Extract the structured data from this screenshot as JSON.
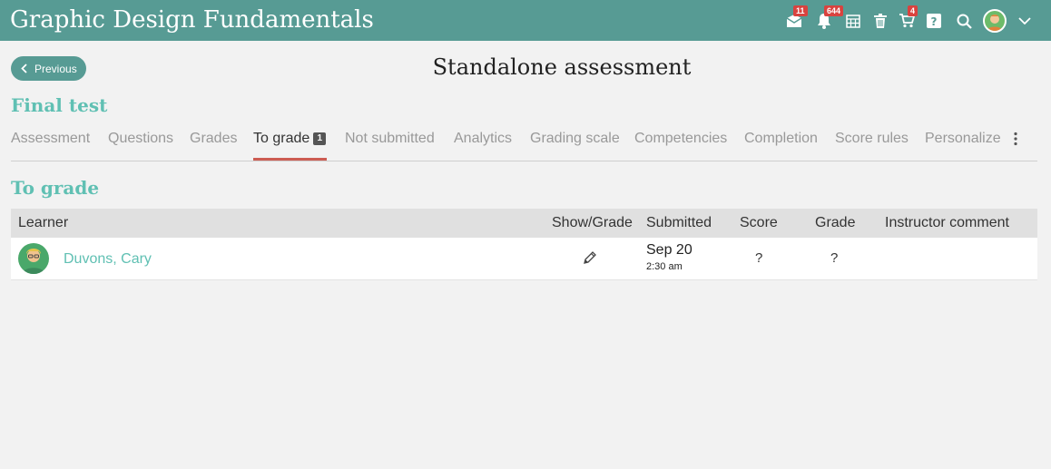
{
  "header": {
    "course_title": "Graphic Design Fundamentals",
    "messages_badge": "11",
    "notifications_badge": "644",
    "cart_badge": "4",
    "icons": [
      "mail-icon",
      "bell-icon",
      "calendar-icon",
      "trash-icon",
      "cart-icon",
      "help-icon",
      "search-icon",
      "user-avatar",
      "chevron-down-icon"
    ]
  },
  "nav": {
    "previous_label": "Previous"
  },
  "page_title": "Standalone assessment",
  "assessment_name": "Final test",
  "tabs": [
    {
      "label": "Assessment"
    },
    {
      "label": "Questions"
    },
    {
      "label": "Grades"
    },
    {
      "label": "To grade",
      "badge": "1",
      "active": true
    },
    {
      "label": "Not submitted"
    },
    {
      "label": "Analytics"
    },
    {
      "label": "Grading scale"
    },
    {
      "label": "Competencies"
    },
    {
      "label": "Completion"
    },
    {
      "label": "Score rules"
    },
    {
      "label": "Personalize"
    }
  ],
  "section_heading": "To grade",
  "table": {
    "columns": [
      "Learner",
      "Show/Grade",
      "Submitted",
      "Score",
      "Grade",
      "Instructor comment"
    ],
    "rows": [
      {
        "learner": "Duvons, Cary",
        "submitted_date": "Sep 20",
        "submitted_time": "2:30 am",
        "score": "?",
        "grade": "?",
        "comment": ""
      }
    ]
  },
  "colors": {
    "header_bg": "#579b94",
    "accent": "#60c0b3",
    "badge": "#d9433f",
    "active_tab_underline": "#cc5c52"
  }
}
